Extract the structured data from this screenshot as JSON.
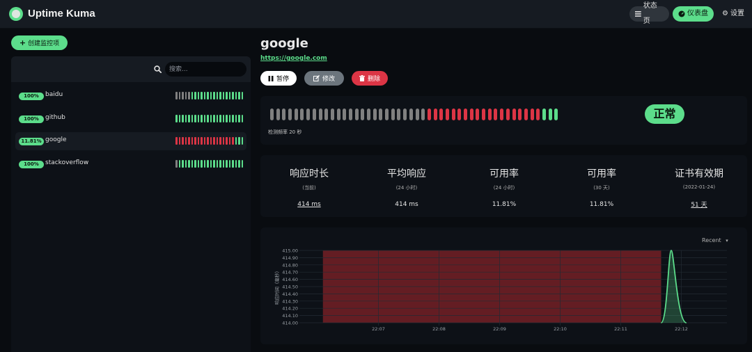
{
  "app": {
    "name": "Uptime Kuma"
  },
  "header": {
    "status_page": "状态页",
    "dashboard": "仪表盘",
    "settings": "设置"
  },
  "sidebar": {
    "create_button": "创建监控项",
    "search_placeholder": "搜索...",
    "monitors": [
      {
        "name": "baidu",
        "uptime": "100%",
        "active": false,
        "beats": "GGGGGUUUUUUUUUUUUUUUUU"
      },
      {
        "name": "github",
        "uptime": "100%",
        "active": false,
        "beats": "UUUUUUUUUUUUUUUUUUUUUU"
      },
      {
        "name": "google",
        "uptime": "11.81%",
        "active": true,
        "beats": "DDDDDDDDDDDDDDDDDDDUUU"
      },
      {
        "name": "stackoverflow",
        "uptime": "100%",
        "active": false,
        "beats": "GUUUUUUUUUUUUUUUUUUUUU"
      }
    ]
  },
  "monitor": {
    "title": "google",
    "url": "https://google.com",
    "pause_label": "暂停",
    "edit_label": "修改",
    "delete_label": "删除",
    "status": "正常",
    "interval": "检测频率 20 秒",
    "heartbeats": "GGGGGGGGGGGGGGGGGGGGGGGGGGDDDDDDDDDDDDDDDDDDDUUU"
  },
  "stats": [
    {
      "title": "响应时长",
      "sub": "(当前)",
      "value": "414 ms",
      "link": true
    },
    {
      "title": "平均响应",
      "sub": "(24 小时)",
      "value": "414 ms",
      "link": false
    },
    {
      "title": "可用率",
      "sub": "(24 小时)",
      "value": "11.81%",
      "link": false
    },
    {
      "title": "可用率",
      "sub": "(30 天)",
      "value": "11.81%",
      "link": false
    },
    {
      "title": "证书有效期",
      "sub": "(2022-01-24)",
      "value": "51 天",
      "link": true
    }
  ],
  "colors": {
    "up": "#5cdd8b",
    "down": "#dc3545",
    "grey": "#808080",
    "down_fill": "#6e1f25"
  },
  "chart_data": {
    "type": "area",
    "range_label": "Recent",
    "ylabel": "响应时间（毫秒）",
    "y_ticks": [
      "415.00",
      "414.90",
      "414.80",
      "414.70",
      "414.60",
      "414.50",
      "414.40",
      "414.30",
      "414.20",
      "414.10",
      "414.00"
    ],
    "ylim": [
      414.0,
      415.0
    ],
    "x_ticks": [
      "22:07",
      "22:08",
      "22:09",
      "22:10",
      "22:11",
      "22:12"
    ],
    "down_period": {
      "start": "22:06:05",
      "end": "22:11:40"
    },
    "series": [
      {
        "points": [
          [
            "22:11:40",
            414.0
          ],
          [
            "22:11:50",
            415.0
          ],
          [
            "22:12:05",
            414.0
          ]
        ]
      }
    ]
  }
}
